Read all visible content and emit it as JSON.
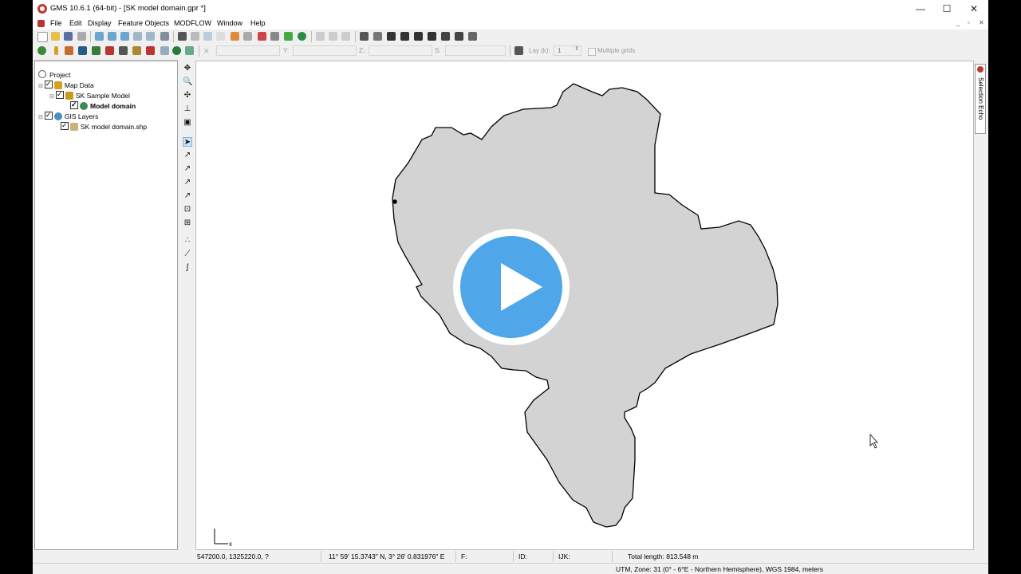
{
  "window": {
    "title": "GMS 10.6.1 (64-bit) - [SK model domain.gpr *]",
    "controls": {
      "minimize": "—",
      "maximize": "☐",
      "close": "✕"
    },
    "mdi_controls": [
      "_",
      "▫",
      "✕"
    ]
  },
  "menu": [
    "File",
    "Edit",
    "Display",
    "Feature Objects",
    "MODFLOW",
    "Window",
    "Help"
  ],
  "coord_toolbar": {
    "x_label": "X:",
    "y_label": "Y:",
    "z_label": "Z:",
    "s_label": "S:",
    "lay_label": "Lay (k):",
    "lay_value": "1",
    "multiple_grids_label": "Multiple grids"
  },
  "project_tree": {
    "root": "Project",
    "items": [
      {
        "label": "Map Data",
        "level": 1,
        "icon": "map-data-icon"
      },
      {
        "label": "SK Sample Model",
        "level": 2,
        "icon": "conceptual-model-icon"
      },
      {
        "label": "Model domain",
        "level": 3,
        "icon": "coverage-icon",
        "bold": true
      },
      {
        "label": "GIS Layers",
        "level": 1,
        "icon": "gis-layers-icon"
      },
      {
        "label": "SK model domain.shp",
        "level": 2,
        "icon": "shapefile-icon"
      }
    ]
  },
  "selection_echo_label": "Selection Echo",
  "status_bar": {
    "cursor_xyz": "547200.0, 1325220.0, ?",
    "lat_lon": "11° 59' 15.3743\" N, 3° 26' 0.831976\" E",
    "f_label": "F:",
    "id_label": "ID:",
    "ijk_label": "IJK:",
    "total_length": "Total length: 813.548 m"
  },
  "projection_bar": {
    "projection": "UTM,  Zone: 31 (0° - 6°E - Northern Hemisphere),  WGS 1984,  meters"
  },
  "colors": {
    "polygon_fill": "#d3d3d3",
    "play_button": "#4fa6e9",
    "selection_highlight": "#cde4f7"
  }
}
